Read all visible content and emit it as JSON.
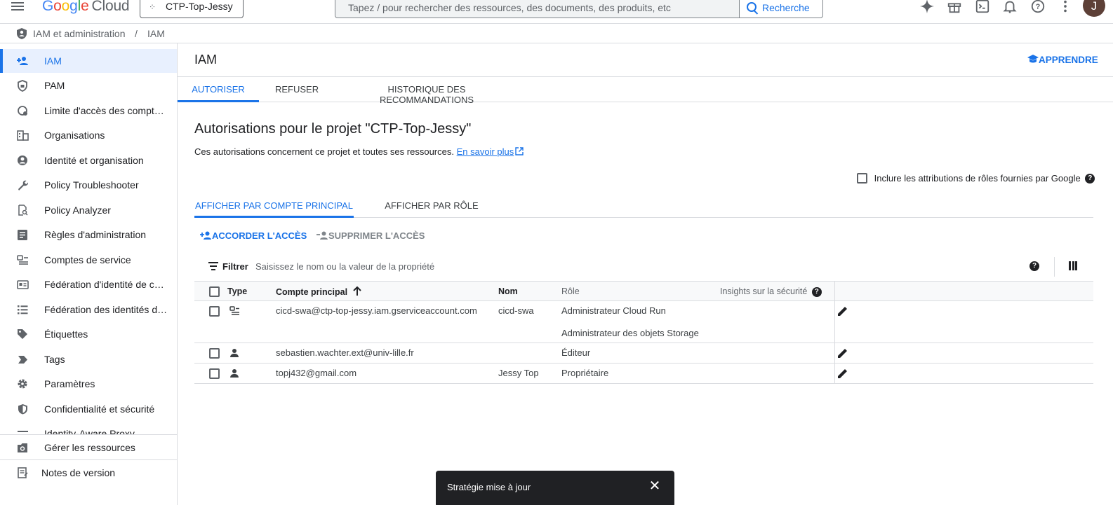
{
  "topbar": {
    "logo_google": [
      "G",
      "o",
      "o",
      "g",
      "l",
      "e"
    ],
    "logo_cloud": "Cloud",
    "project": "CTP-Top-Jessy",
    "search_placeholder": "Tapez / pour rechercher des ressources, des documents, des produits, etc",
    "search_button": "Recherche",
    "avatar_letter": "J"
  },
  "breadcrumb": {
    "root": "IAM et administration",
    "separator": "/",
    "current": "IAM"
  },
  "sidebar": {
    "items": [
      {
        "label": "IAM",
        "icon": "person-add-icon"
      },
      {
        "label": "PAM",
        "icon": "shield-lock-icon"
      },
      {
        "label": "Limite d'accès des comptes principaux",
        "icon": "access-boundary-icon"
      },
      {
        "label": "Organisations",
        "icon": "business-icon"
      },
      {
        "label": "Identité et organisation",
        "icon": "account-circle-icon"
      },
      {
        "label": "Policy Troubleshooter",
        "icon": "wrench-icon"
      },
      {
        "label": "Policy Analyzer",
        "icon": "document-search-icon"
      },
      {
        "label": "Règles d'administration",
        "icon": "policy-list-icon"
      },
      {
        "label": "Comptes de service",
        "icon": "service-account-icon"
      },
      {
        "label": "Fédération d'identité de charge de travail",
        "icon": "id-card-icon"
      },
      {
        "label": "Fédération des identités de personnel",
        "icon": "list-icon"
      },
      {
        "label": "Étiquettes",
        "icon": "label-icon"
      },
      {
        "label": "Tags",
        "icon": "tag-icon"
      },
      {
        "label": "Paramètres",
        "icon": "gear-icon"
      },
      {
        "label": "Confidentialité et sécurité",
        "icon": "shield-icon"
      },
      {
        "label": "Identity-Aware Proxy",
        "icon": "proxy-icon"
      }
    ],
    "bottom": [
      {
        "label": "Gérer les ressources",
        "icon": "manage-resources-icon"
      },
      {
        "label": "Notes de version",
        "icon": "release-notes-icon"
      }
    ]
  },
  "header": {
    "title": "IAM",
    "learn": "APPRENDRE"
  },
  "main_tabs": [
    "AUTORISER",
    "REFUSER",
    "HISTORIQUE DES RECOMMANDATIONS"
  ],
  "section": {
    "title": "Autorisations pour le projet \"CTP-Top-Jessy\"",
    "description": "Ces autorisations concernent ce projet et toutes ses ressources.",
    "learn_more": "En savoir plus",
    "include_google": "Inclure les attributions de rôles fournies par Google"
  },
  "view_tabs": [
    "AFFICHER PAR COMPTE PRINCIPAL",
    "AFFICHER PAR RÔLE"
  ],
  "actions": {
    "grant": "ACCORDER L'ACCÈS",
    "remove": "SUPPRIMER L'ACCÈS"
  },
  "filter": {
    "label": "Filtrer",
    "placeholder": "Saisissez le nom ou la valeur de la propriété"
  },
  "table": {
    "headers": {
      "type": "Type",
      "principal": "Compte principal",
      "name": "Nom",
      "role": "Rôle",
      "insights": "Insights sur la sécurité"
    },
    "rows": [
      {
        "type": "service-account",
        "principal": "cicd-swa@ctp-top-jessy.iam.gserviceaccount.com",
        "name": "cicd-swa",
        "roles": [
          "Administrateur Cloud Run",
          "Administrateur des objets Storage"
        ]
      },
      {
        "type": "user",
        "principal": "sebastien.wachter.ext@univ-lille.fr",
        "name": "",
        "roles": [
          "Éditeur"
        ]
      },
      {
        "type": "user",
        "principal": "topj432@gmail.com",
        "name": "Jessy Top",
        "roles": [
          "Propriétaire"
        ]
      }
    ]
  },
  "snackbar": {
    "message": "Stratégie mise à jour"
  },
  "colors": {
    "accent": "#1a73e8",
    "active_bg": "#e8f0fe"
  }
}
